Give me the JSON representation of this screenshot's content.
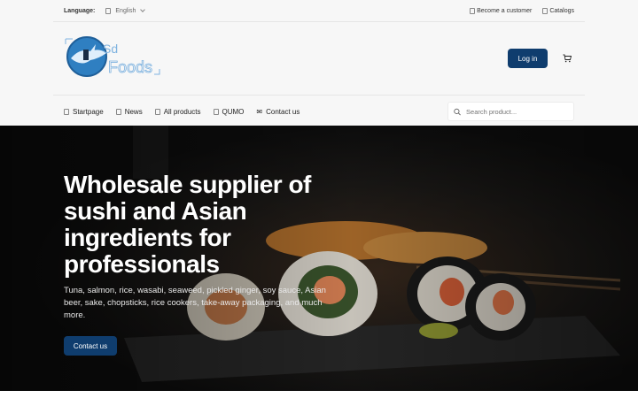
{
  "topbar": {
    "language_label": "Language:",
    "language_value": "English",
    "become_customer": "Become a customer",
    "catalogs": "Catalogs"
  },
  "logo": {
    "text_top": "Sd",
    "text_bottom": "Foods"
  },
  "header": {
    "login_label": "Log in"
  },
  "nav": {
    "items": [
      {
        "label": "Startpage",
        "icon": "home-icon"
      },
      {
        "label": "News",
        "icon": "news-icon"
      },
      {
        "label": "All products",
        "icon": "grid-icon"
      },
      {
        "label": "QUMO",
        "icon": "tag-icon"
      },
      {
        "label": "Contact us",
        "icon": "mail-icon"
      }
    ],
    "search_placeholder": "Search product..."
  },
  "hero": {
    "title": "Wholesale supplier of sushi and Asian ingredients for professionals",
    "text": "Tuna, salmon, rice, wasabi, seaweed, pickled ginger, soy sauce, Asian beer, sake, chopsticks, rice cookers, take-away packaging, and much more.",
    "cta_label": "Contact us"
  },
  "colors": {
    "brand": "#0f3d6e",
    "logo_blue": "#2f7fc1"
  }
}
